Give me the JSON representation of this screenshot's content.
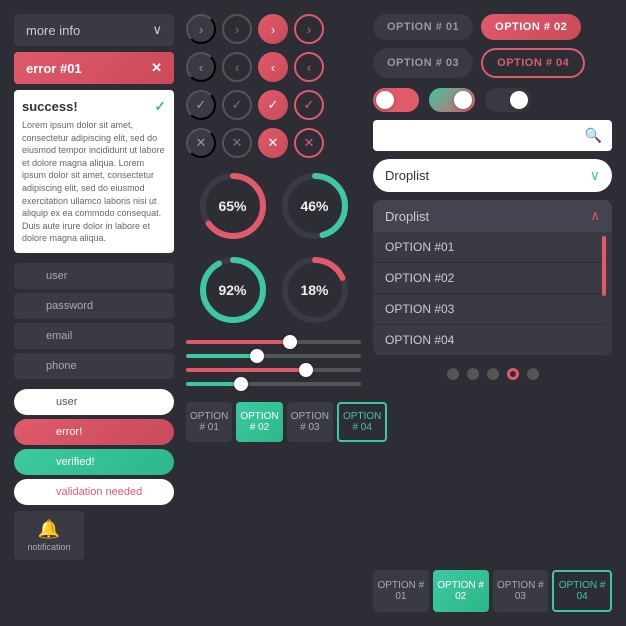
{
  "left": {
    "dropdown_label": "more info",
    "dropdown_arrow": "∨",
    "error_label": "error #01",
    "error_x": "✕",
    "success_title": "success!",
    "success_check": "✓",
    "success_text": "Lorem ipsum dolor sit amet, consectetur adipiscing elit, sed do eiusmod tempor incididunt ut labore et dolore magna aliqua. Lorem ipsum dolor sit amet, consectetur adipiscing elit, sed do eiusmod exercitation ullamco laboris nisi ut aliquip ex ea commodo consequat. Duis aute irure dolor in labore et dolore magna aliqua.",
    "input_user": "user",
    "input_password": "password",
    "input_email": "email",
    "input_phone": "phone",
    "flat_user": "user",
    "flat_error": "error!",
    "flat_verified": "verified!",
    "flat_validation": "validation needed",
    "notification_label": "notification",
    "bell": "🔔"
  },
  "mid": {
    "chevron_right_plain": "›",
    "chevron_right_outline": "›",
    "chevron_right_pink_filled": "›",
    "chevron_right_outline_gray": "›",
    "chevron_left_plain": "‹",
    "chevron_left_outline": "‹",
    "chevron_left_pink_filled": "‹",
    "chevron_left_outline_gray": "‹",
    "check_plain": "✓",
    "check_outline": "✓",
    "check_pink_filled": "✓",
    "check_outline_gray": "✓",
    "x_plain": "✕",
    "x_outline": "✕",
    "x_pink_filled": "✕",
    "x_outline_gray": "✕",
    "progress_1_pct": "65%",
    "progress_1_val": 65,
    "progress_2_pct": "46%",
    "progress_2_val": 46,
    "progress_3_pct": "92%",
    "progress_3_val": 92,
    "progress_4_pct": "18%",
    "progress_4_val": 18,
    "tab1": "OPTION # 01",
    "tab2": "OPTION # 02",
    "tab3": "OPTION # 03",
    "tab4": "OPTION # 04"
  },
  "right": {
    "opt1": "OPTION # 01",
    "opt2": "OPTION # 02",
    "opt3": "OPTION # 03",
    "opt4": "OPTION # 04",
    "search_placeholder": "Search...",
    "droplist_closed_label": "Droplist",
    "droplist_open_label": "Droplist",
    "drop_opt1": "OPTION #01",
    "drop_opt2": "OPTION #02",
    "drop_opt3": "OPTION #03",
    "drop_opt4": "OPTION #04",
    "tab1": "OPTION # 01",
    "tab2": "OPTION # 02",
    "tab3": "OPTION # 03",
    "tab4": "OPTION # 04"
  }
}
